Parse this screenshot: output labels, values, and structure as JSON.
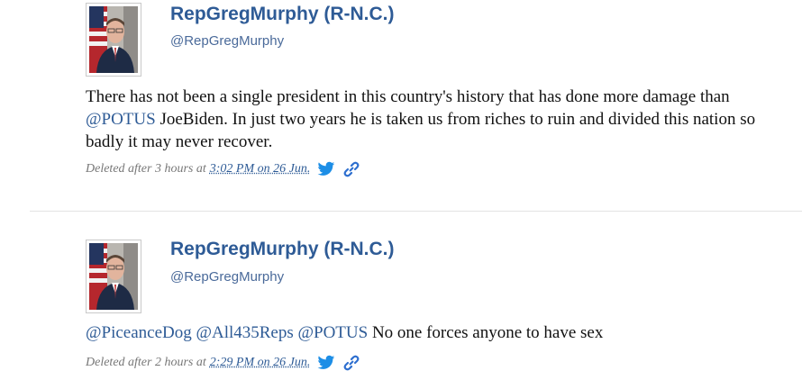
{
  "colors": {
    "name": "#2e5b96",
    "mention": "#2e5b96",
    "meta_text": "#777777",
    "twitter_blue": "#1d8ee6",
    "divider": "#e3e3e3"
  },
  "tweets": [
    {
      "display_name": "RepGregMurphy (R-N.C.)",
      "handle": "@RepGregMurphy",
      "text_parts": [
        "There has not been a single president in this country's history that has done more damage than ",
        "@POTUS",
        " JoeBiden. In just two years he is taken us from riches to ruin and divided this nation so badly it may never recover."
      ],
      "deleted_label": "Deleted after 3 hours at",
      "time_label": "3:02 PM on 26 Jun.",
      "icons": [
        "twitter-bird-icon",
        "link-icon"
      ]
    },
    {
      "display_name": "RepGregMurphy (R-N.C.)",
      "handle": "@RepGregMurphy",
      "mentions": [
        "@PiceanceDog",
        "@All435Reps",
        "@POTUS"
      ],
      "body": "No one forces anyone to have sex",
      "deleted_label": "Deleted after 2 hours at",
      "time_label": "2:29 PM on 26 Jun.",
      "icons": [
        "twitter-bird-icon",
        "link-icon"
      ]
    }
  ]
}
